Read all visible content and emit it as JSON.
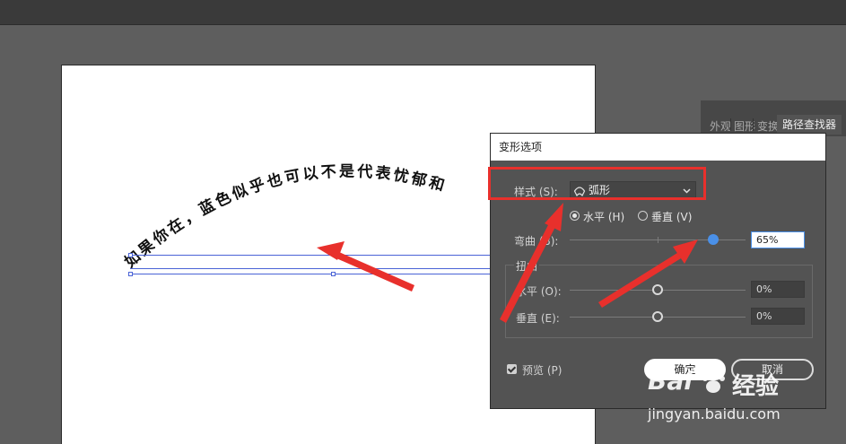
{
  "canvas": {
    "arc_text": "如果你在，蓝色似乎也可以不是代表忧郁和"
  },
  "panel": {
    "tabs": [
      "外观",
      "图形",
      "变换",
      "路径查找器"
    ]
  },
  "dialog": {
    "title": "变形选项",
    "style_label": "样式 (S):",
    "style_value": "弧形",
    "orientation": {
      "horizontal_label": "水平 (H)",
      "vertical_label": "垂直 (V)",
      "selected": "horizontal"
    },
    "bend": {
      "label": "弯曲 (B):",
      "value": "65%",
      "percent": 65
    },
    "distortion": {
      "group_label": "扭曲",
      "horizontal_label": "水平 (O):",
      "horizontal_value": "0%",
      "vertical_label": "垂直 (E):",
      "vertical_value": "0%"
    },
    "preview_label": "预览 (P)",
    "preview_checked": true,
    "ok_label": "确定",
    "cancel_label": "取消"
  },
  "watermark": {
    "brand": "Bai",
    "suffix": "经验",
    "url": "jingyan.baidu.com"
  },
  "colors": {
    "annotation_red": "#e8302c",
    "slider_accent": "#4a90e8",
    "selection_blue": "#4a63d6"
  },
  "icons": [
    "arc-style-icon",
    "chevron-down-icon",
    "paw-icon",
    "red-arrow-icon"
  ]
}
